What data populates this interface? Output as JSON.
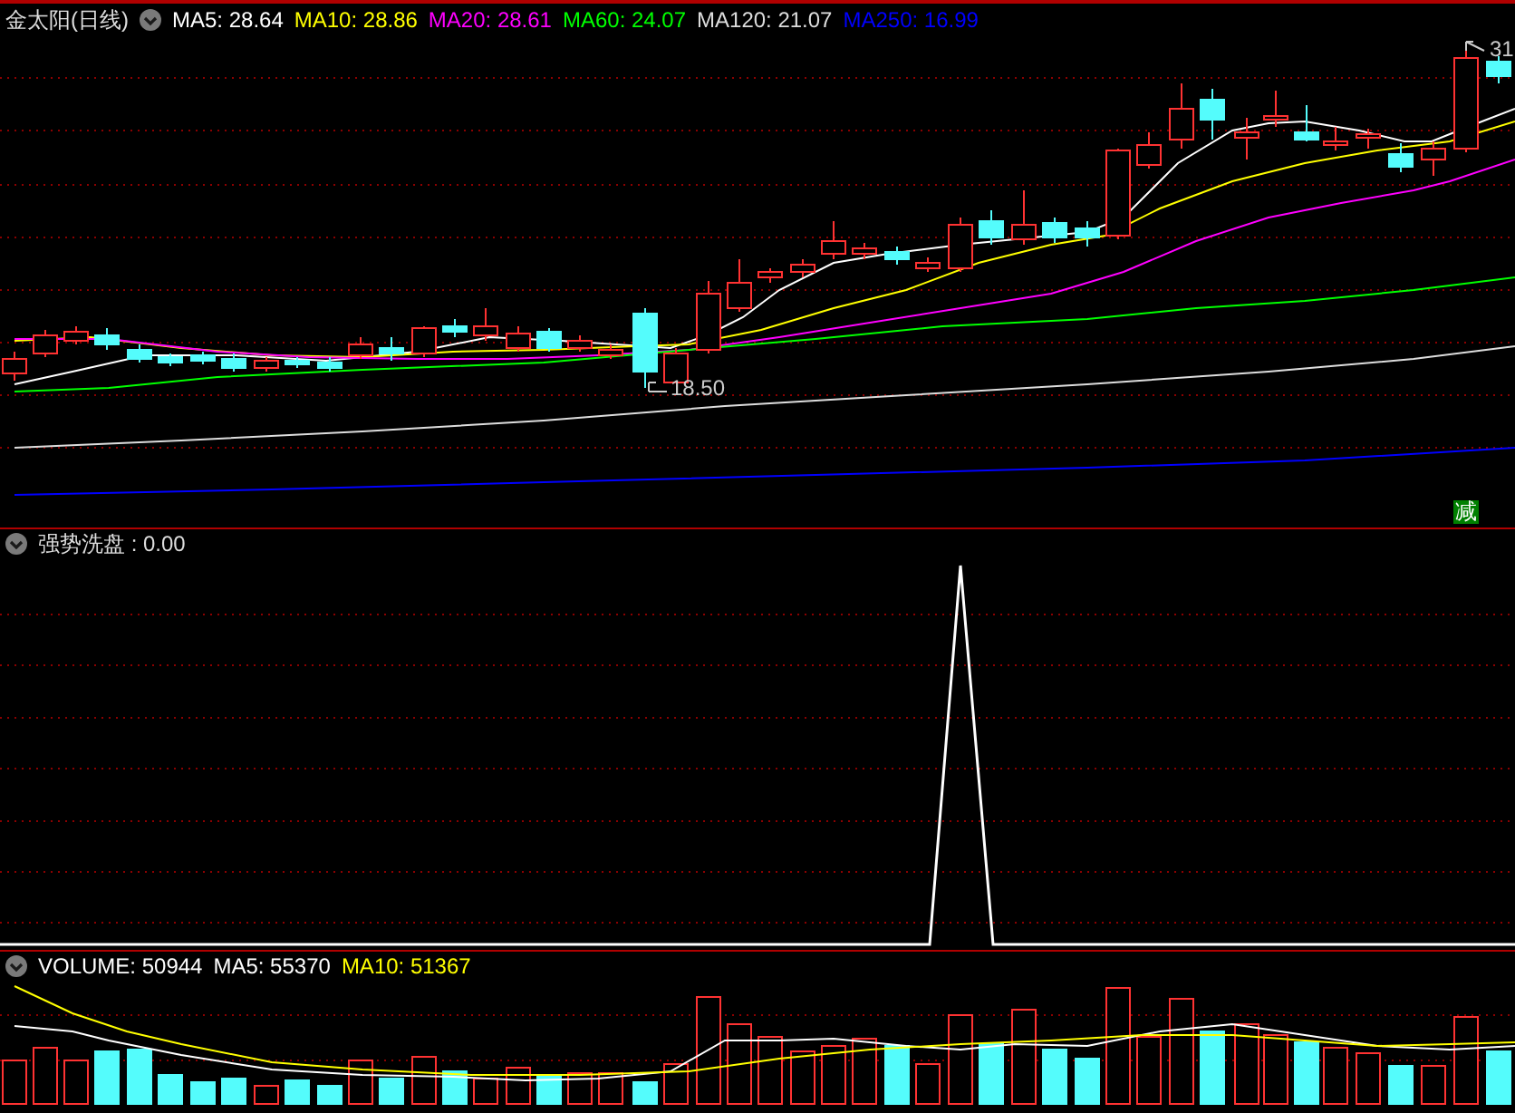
{
  "price_panel": {
    "title": "金太阳(日线)",
    "indicators": [
      {
        "label": "MA5: 28.64",
        "color": "#ffffff"
      },
      {
        "label": "MA10: 28.86",
        "color": "#ffff00"
      },
      {
        "label": "MA20: 28.61",
        "color": "#ff00ff"
      },
      {
        "label": "MA60: 24.07",
        "color": "#00ff00"
      },
      {
        "label": "MA120: 21.07",
        "color": "#dddddd"
      },
      {
        "label": "MA250: 16.99",
        "color": "#0000ff"
      }
    ],
    "high_label": "31",
    "low_label": "18.50",
    "signal_badge": "减"
  },
  "indicator_panel": {
    "title": "强势洗盘 : 0.00"
  },
  "volume_panel": {
    "indicators": [
      {
        "label": "VOLUME: 50944",
        "color": "#ffffff"
      },
      {
        "label": "MA5: 55370",
        "color": "#ffffff"
      },
      {
        "label": "MA10: 51367",
        "color": "#ffff00"
      }
    ]
  }
}
